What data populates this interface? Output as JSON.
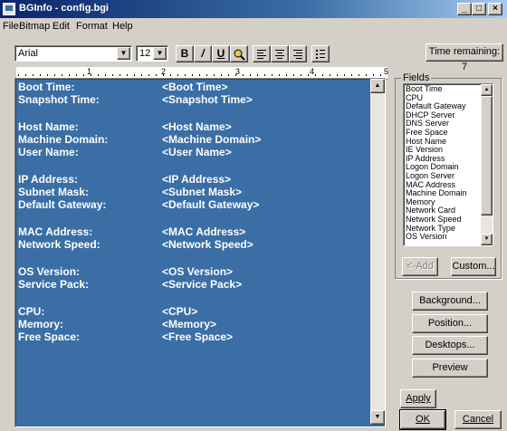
{
  "window": {
    "title": "BGInfo - config.bgi",
    "controls": {
      "minimize": "_",
      "maximize": "□",
      "close": "×"
    }
  },
  "menu": [
    "File",
    "Bitmap",
    "Edit",
    "Format",
    "Help"
  ],
  "toolbar": {
    "font": "Arial",
    "size": "12",
    "bold": "B",
    "italic": "/",
    "underline": "U",
    "time_remaining": "Time remaining: 7"
  },
  "ruler": [
    "1",
    "2",
    "3",
    "4",
    "5"
  ],
  "editor": {
    "rows": [
      {
        "label": "Boot Time:",
        "value": "<Boot Time>"
      },
      {
        "label": "Snapshot Time:",
        "value": "<Snapshot Time>"
      },
      {
        "label": "Host Name:",
        "value": "<Host Name>"
      },
      {
        "label": "Machine Domain:",
        "value": "<Machine Domain>"
      },
      {
        "label": "User Name:",
        "value": "<User Name>"
      },
      {
        "label": "IP Address:",
        "value": "<IP Address>"
      },
      {
        "label": "Subnet Mask:",
        "value": "<Subnet Mask>"
      },
      {
        "label": "Default Gateway:",
        "value": "<Default Gateway>"
      },
      {
        "label": "MAC Address:",
        "value": "<MAC Address>"
      },
      {
        "label": "Network Speed:",
        "value": "<Network Speed>"
      },
      {
        "label": "OS Version:",
        "value": "<OS Version>"
      },
      {
        "label": "Service Pack:",
        "value": "<Service Pack>"
      },
      {
        "label": "CPU:",
        "value": "<CPU>"
      },
      {
        "label": "Memory:",
        "value": "<Memory>"
      },
      {
        "label": "Free Space:",
        "value": "<Free Space>"
      }
    ]
  },
  "fields": {
    "legend": "Fields",
    "items": [
      "Boot Time",
      "CPU",
      "Default Gateway",
      "DHCP Server",
      "DNS Server",
      "Free Space",
      "Host Name",
      "IE Version",
      "IP Address",
      "Logon Domain",
      "Logon Server",
      "MAC Address",
      "Machine Domain",
      "Memory",
      "Network Card",
      "Network Speed",
      "Network Type",
      "OS Version"
    ],
    "add": "<-Add",
    "custom": "Custom..."
  },
  "buttons": {
    "background": "Background...",
    "position": "Position...",
    "desktops": "Desktops...",
    "preview": "Preview",
    "apply": "Apply",
    "ok": "OK",
    "cancel": "Cancel"
  }
}
